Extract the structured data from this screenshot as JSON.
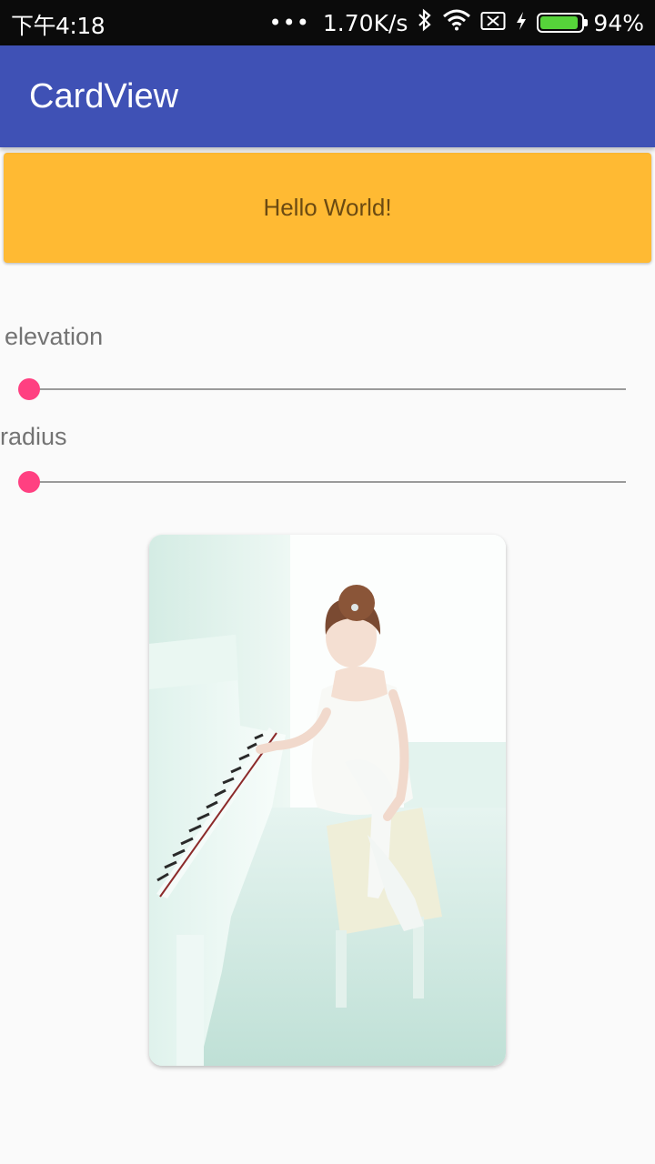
{
  "status_bar": {
    "time": "下午4:18",
    "more": "•••",
    "net_speed": "1.70K/s",
    "icons": [
      "bluetooth-icon",
      "wifi-icon",
      "sim-off-icon",
      "charging-icon",
      "battery-icon"
    ],
    "battery_level": 0.94,
    "battery_text": "94%",
    "battery_color": "#56d33a"
  },
  "app_bar": {
    "title": "CardView",
    "color": "#3f51b5"
  },
  "hello_card": {
    "text": "Hello World!",
    "color": "#ffba33"
  },
  "controls": {
    "elevation_label": "elevation",
    "elevation_value": 0,
    "radius_label": "radius",
    "radius_value": 0,
    "accent_color": "#ff4081"
  },
  "photo_card": {
    "image": "photo of a girl in a white dress playing a white piano"
  }
}
